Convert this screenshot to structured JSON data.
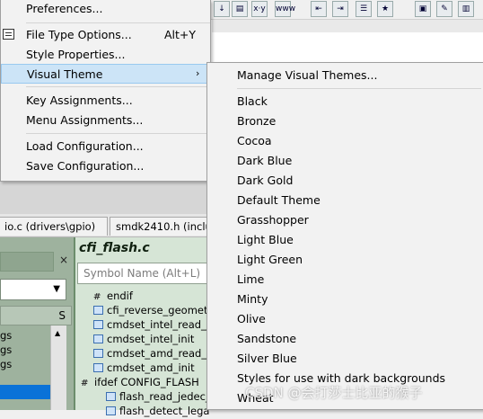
{
  "menu": {
    "items": [
      {
        "label": "Preferences...",
        "shortcut": ""
      },
      {
        "label": "File Type Options...",
        "shortcut": "Alt+Y"
      },
      {
        "label": "Style Properties...",
        "shortcut": ""
      },
      {
        "label": "Visual Theme",
        "shortcut": ""
      },
      {
        "label": "Key Assignments...",
        "shortcut": ""
      },
      {
        "label": "Menu Assignments...",
        "shortcut": ""
      },
      {
        "label": "Load Configuration...",
        "shortcut": ""
      },
      {
        "label": "Save Configuration...",
        "shortcut": ""
      }
    ],
    "submenu_arrow": "›"
  },
  "submenu": {
    "manage": "Manage Visual Themes...",
    "themes": [
      "Black",
      "Bronze",
      "Cocoa",
      "Dark Blue",
      "Dark Gold",
      "Default Theme",
      "Grasshopper",
      "Light Blue",
      "Light Green",
      "Lime",
      "Minty",
      "Olive",
      "Sandstone",
      "Silver Blue",
      "Styles for use with dark backgrounds",
      "Wheat"
    ]
  },
  "tabs": [
    "io.c (drivers\\gpio)",
    "smdk2410.h (inclu"
  ],
  "toolbar": {
    "xy_label": "x·y",
    "www_label": "www"
  },
  "code_panel": {
    "title": "cfi_flash.c",
    "symbol_placeholder": "Symbol Name (Alt+L)",
    "symbols": [
      "endif",
      "cfi_reverse_geometry",
      "cmdset_intel_read_je",
      "cmdset_intel_init",
      "cmdset_amd_read_je",
      "cmdset_amd_init",
      "ifdef CONFIG_FLASH",
      "flash_read_jedec_i",
      "flash_detect_lega"
    ]
  },
  "left_panel": {
    "close": "×",
    "col_s": "S",
    "rows": [
      "gs",
      "gs",
      "gs"
    ]
  },
  "watermark": "CSDN @会打莎士比亚的猴子",
  "colors": {
    "highlight": "#cce4f7",
    "selection": "#0a72d8",
    "panel_green": "#d6e5d6"
  }
}
